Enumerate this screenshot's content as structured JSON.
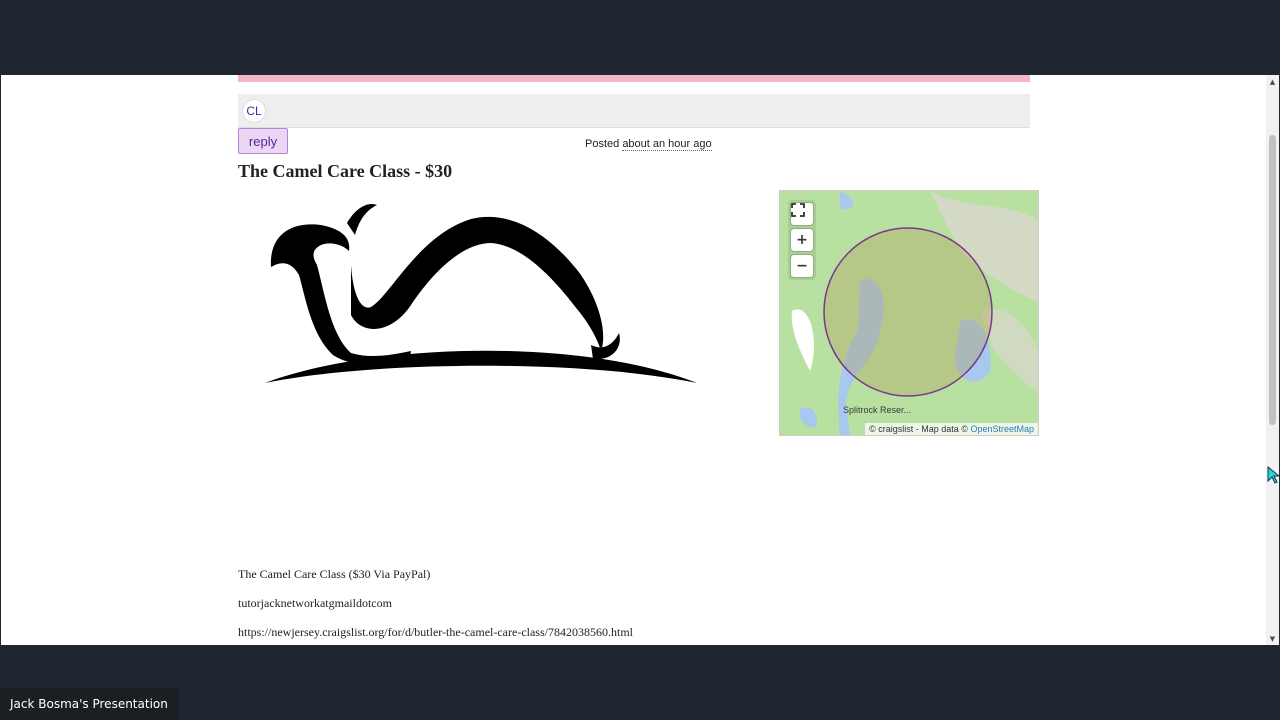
{
  "header": {
    "logo_text": "CL",
    "reply_label": "reply"
  },
  "posting": {
    "posted_prefix": "Posted",
    "posted_when": "about an hour ago",
    "title": "The Camel Care Class - $30",
    "body_lines": [
      "The Camel Care Class ($30 Via PayPal)",
      "tutorjacknetworkatgmaildotcom",
      "https://newjersey.craigslist.org/for/d/butler-the-camel-care-class/7842038560.html"
    ]
  },
  "map": {
    "fullscreen_icon": "fullscreen-icon",
    "zoom_in_label": "+",
    "zoom_out_label": "−",
    "place_label": "Splitrock Reser...",
    "attribution_prefix": "© craigslist - Map data ©",
    "attribution_link": "OpenStreetMap"
  },
  "presentation": {
    "presenter_label": "Jack Bosma's Presentation"
  },
  "scrollbar": {
    "up_icon": "▲",
    "down_icon": "▼"
  }
}
